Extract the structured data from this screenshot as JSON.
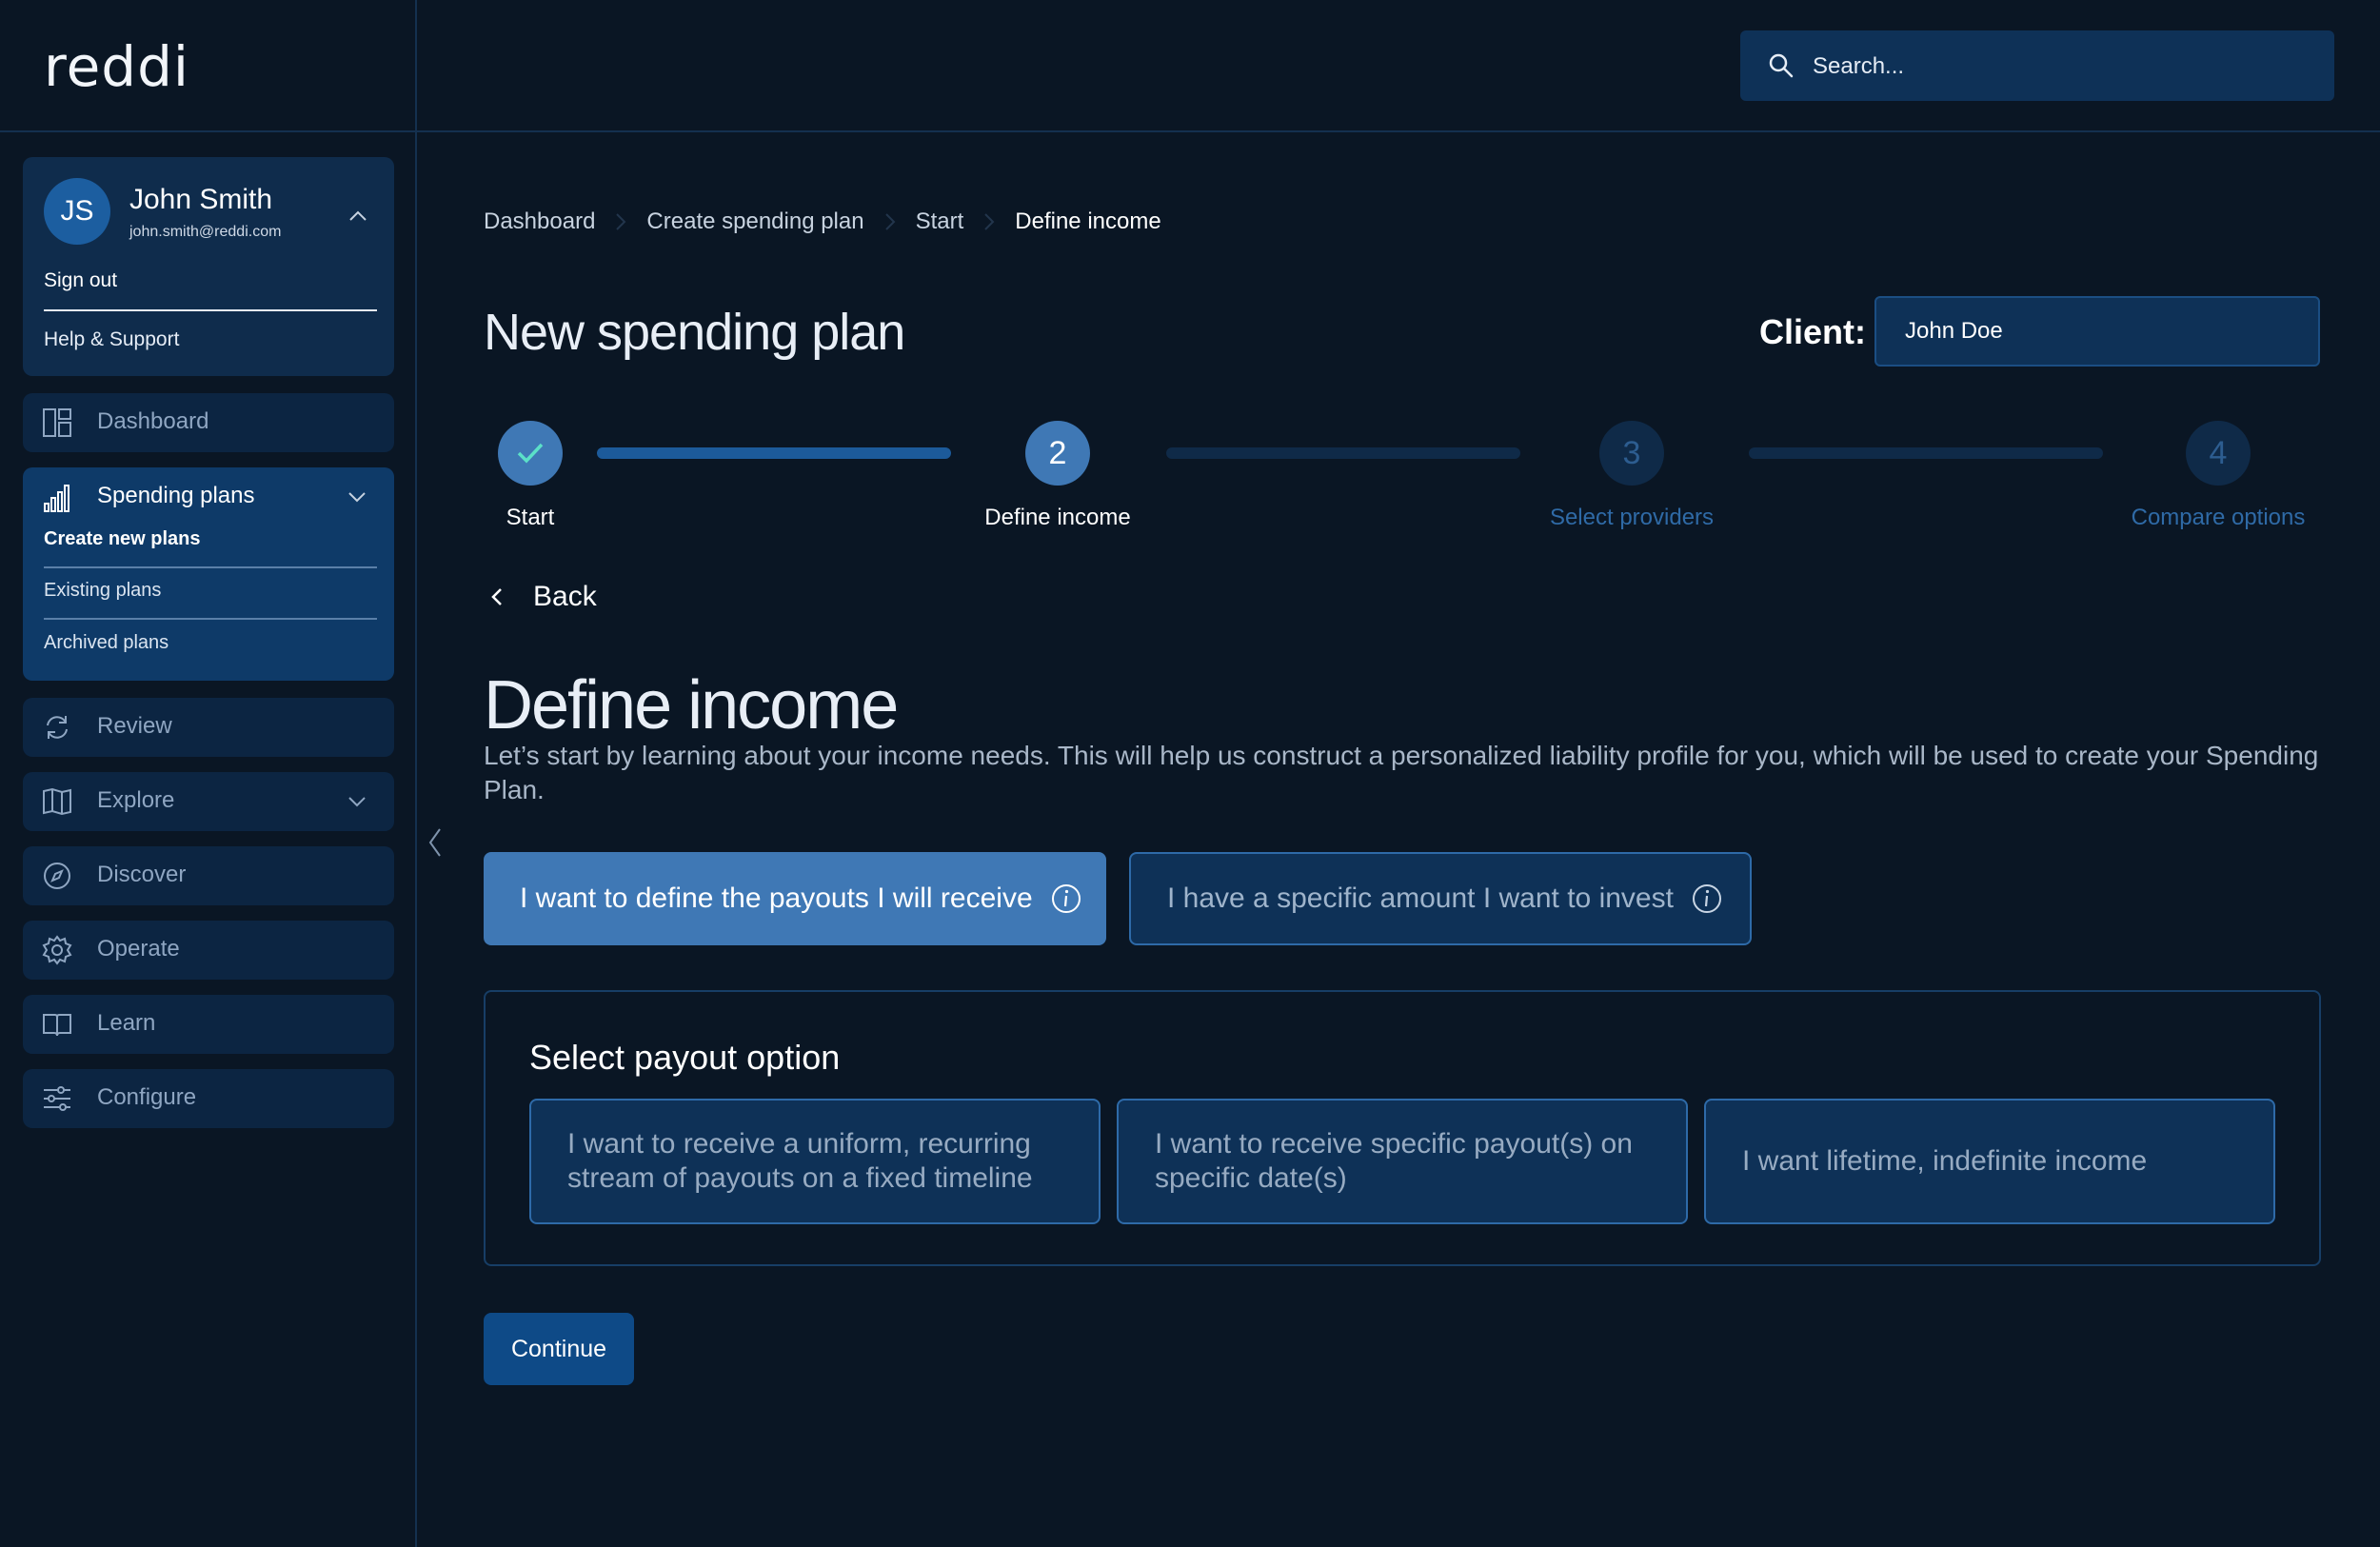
{
  "app": {
    "logo": "reddi"
  },
  "search": {
    "placeholder": "Search..."
  },
  "profile": {
    "initials": "JS",
    "name": "John Smith",
    "email": "john.smith@reddi.com",
    "sign_out": "Sign out",
    "help": "Help & Support"
  },
  "nav": {
    "dashboard": "Dashboard",
    "spending_plans": {
      "label": "Spending plans",
      "items": [
        "Create new plans",
        "Existing plans",
        "Archived plans"
      ]
    },
    "review": "Review",
    "explore": "Explore",
    "discover": "Discover",
    "operate": "Operate",
    "learn": "Learn",
    "configure": "Configure"
  },
  "breadcrumb": [
    "Dashboard",
    "Create spending plan",
    "Start",
    "Define income"
  ],
  "page": {
    "title": "New spending plan",
    "client_label": "Client:",
    "client_value": "John Doe"
  },
  "stepper": {
    "steps": [
      {
        "number": "",
        "label": "Start",
        "status": "complete"
      },
      {
        "number": "2",
        "label": "Define income",
        "status": "current"
      },
      {
        "number": "3",
        "label": "Select providers",
        "status": "upcoming"
      },
      {
        "number": "4",
        "label": "Compare options",
        "status": "upcoming"
      }
    ]
  },
  "back_label": "Back",
  "define": {
    "heading": "Define income",
    "description": "Let’s start by learning about your income needs. This will help us construct a personalized liability profile for you, which will be used to create your Spending Plan."
  },
  "mode_toggle": {
    "option_a": "I want to define the payouts I will receive",
    "option_b": "I have a specific amount I want to invest",
    "selected": "option_a"
  },
  "payout": {
    "title": "Select payout option",
    "options": [
      "I want to receive a uniform, recurring stream of payouts on a fixed timeline",
      "I want to receive specific payout(s) on specific date(s)",
      "I want lifetime, indefinite income"
    ]
  },
  "continue_label": "Continue",
  "colors": {
    "background": "#0a1624",
    "accent": "#3f78b5",
    "panel": "#0e3157",
    "border": "#14304f"
  }
}
